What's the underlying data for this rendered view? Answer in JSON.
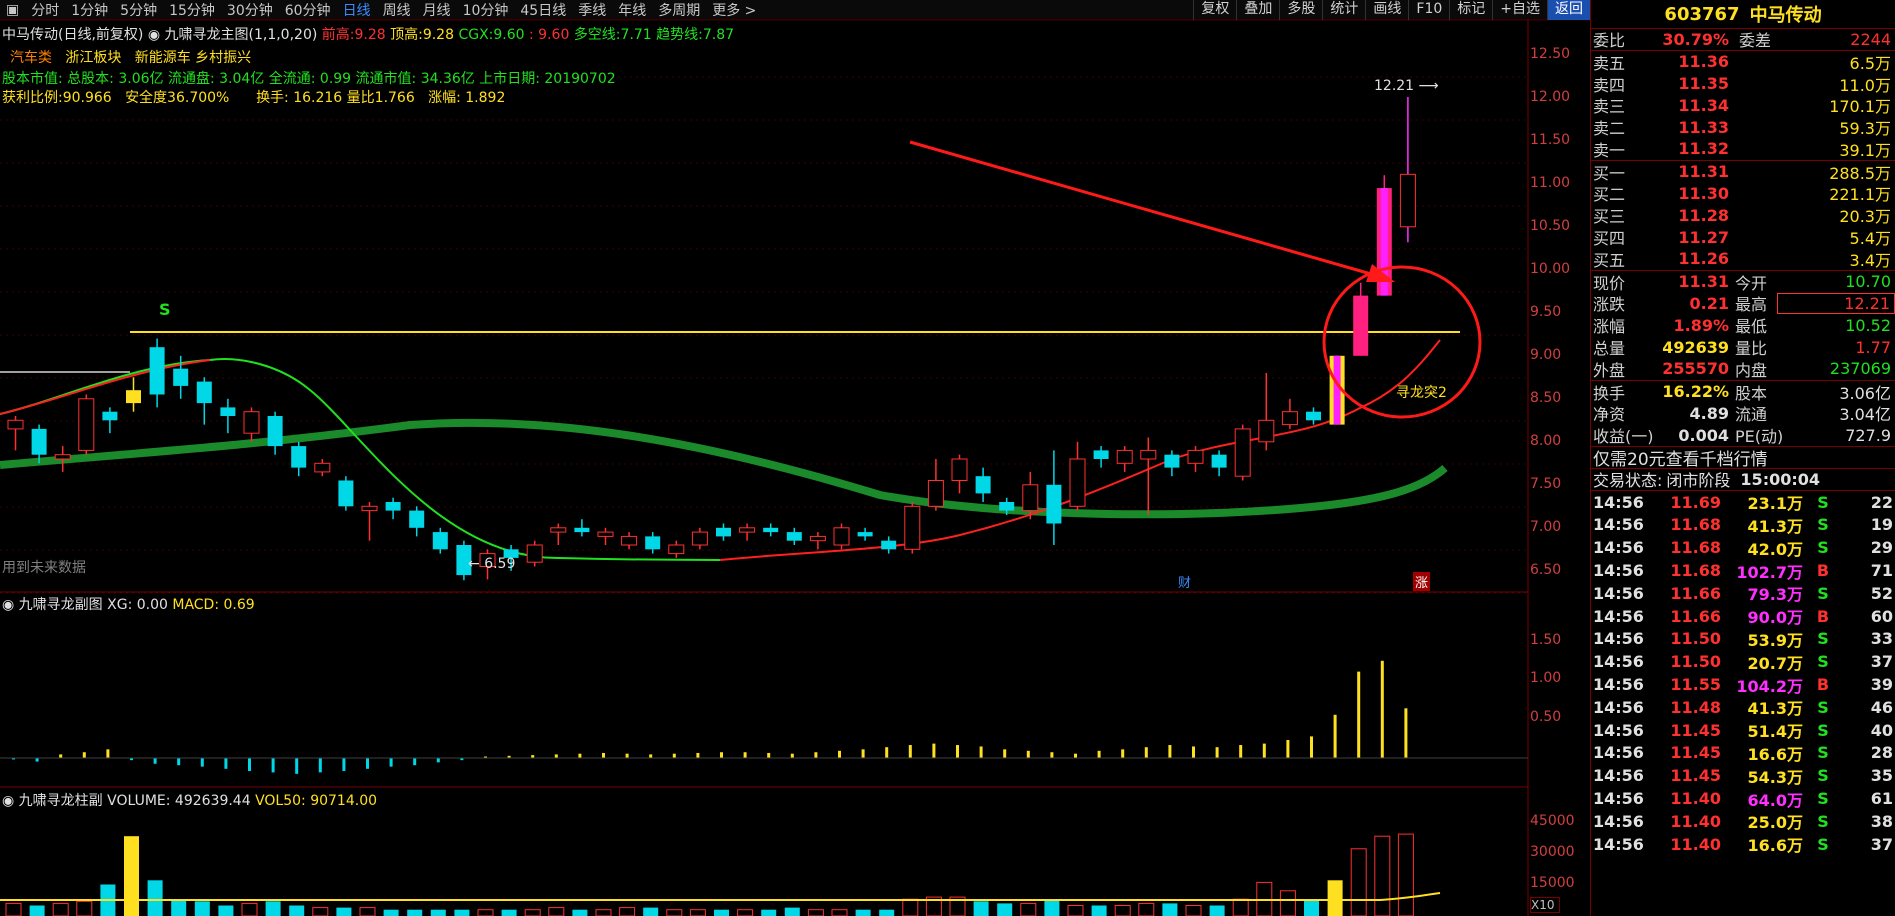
{
  "toolbar": {
    "periods": [
      "分时",
      "1分钟",
      "5分钟",
      "15分钟",
      "30分钟",
      "60分钟",
      "日线",
      "周线",
      "月线",
      "10分钟",
      "45日线",
      "季线",
      "年线",
      "多周期",
      "更多"
    ],
    "active_period": "日线",
    "tools": [
      "复权",
      "叠加",
      "多股",
      "统计",
      "画线",
      "F10",
      "标记",
      "+自选",
      "返回"
    ]
  },
  "main_chart": {
    "title": "中马传动(日线,前复权)",
    "indicator_name": "九啸寻龙主图(1,1,0,20)",
    "qianhigh_label": "前高:",
    "qianhigh": "9.28",
    "dinggao_label": "顶高:",
    "dinggao": "9.28",
    "cgx_label": "CGX:",
    "cgx": "9.60",
    "extra_val": ": 9.60",
    "duokong_label": "多空线:",
    "duokong": "7.71",
    "qushi_label": "趋势线:",
    "qushi": "7.87",
    "sectors": [
      "汽车类",
      "浙江板块",
      "新能源车",
      "乡村振兴"
    ],
    "line3": "股本市值: 总股本: 3.06亿 流通盘: 3.04亿 全流通: 0.99 流通市值: 34.36亿 上市日期: 20190702",
    "line4_a": "获利比例:90.966",
    "line4_b": "安全度36.700%",
    "line4_c": "换手: 16.216 量比1.766",
    "line4_d": "涨幅: 1.892",
    "future_data_note": "用到未来数据",
    "high_label": "12.21",
    "low_label": "6.59",
    "signal_label": "寻龙突2",
    "s_marker": "S",
    "cai_marker": "财",
    "zhang_marker": "涨",
    "y_ticks": [
      "12.50",
      "12.00",
      "11.50",
      "11.00",
      "10.50",
      "10.00",
      "9.50",
      "9.00",
      "8.50",
      "8.00",
      "7.50",
      "7.00",
      "6.50"
    ]
  },
  "sub_chart1": {
    "title": "九啸寻龙副图",
    "xg": "XG: 0.00",
    "macd": "MACD: 0.69",
    "y_ticks": [
      "1.50",
      "1.00",
      "0.50"
    ]
  },
  "sub_chart2": {
    "title": "九啸寻龙柱副",
    "volume": "VOLUME: 492639.44",
    "vol50": "VOL50: 90714.00",
    "y_ticks": [
      "45000",
      "30000",
      "15000"
    ],
    "unit": "X10"
  },
  "quote": {
    "code": "603767",
    "name": "中马传动",
    "weibi_label": "委比",
    "weibi": "30.79%",
    "weicha_label": "委差",
    "weicha": "2244",
    "asks": [
      {
        "label": "卖五",
        "price": "11.36",
        "vol": "6.5万"
      },
      {
        "label": "卖四",
        "price": "11.35",
        "vol": "11.0万"
      },
      {
        "label": "卖三",
        "price": "11.34",
        "vol": "170.1万"
      },
      {
        "label": "卖二",
        "price": "11.33",
        "vol": "59.3万"
      },
      {
        "label": "卖一",
        "price": "11.32",
        "vol": "39.1万"
      }
    ],
    "bids": [
      {
        "label": "买一",
        "price": "11.31",
        "vol": "288.5万"
      },
      {
        "label": "买二",
        "price": "11.30",
        "vol": "221.1万"
      },
      {
        "label": "买三",
        "price": "11.28",
        "vol": "20.3万"
      },
      {
        "label": "买四",
        "price": "11.27",
        "vol": "5.4万"
      },
      {
        "label": "买五",
        "price": "11.26",
        "vol": "3.4万"
      }
    ],
    "stats": [
      {
        "l1": "现价",
        "v1": "11.31",
        "c1": "red",
        "l2": "今开",
        "v2": "10.70",
        "c2": "green"
      },
      {
        "l1": "涨跌",
        "v1": "0.21",
        "c1": "red",
        "l2": "最高",
        "v2": "12.21",
        "c2": "red"
      },
      {
        "l1": "涨幅",
        "v1": "1.89%",
        "c1": "red",
        "l2": "最低",
        "v2": "10.52",
        "c2": "green"
      },
      {
        "l1": "总量",
        "v1": "492639",
        "c1": "yellow",
        "l2": "量比",
        "v2": "1.77",
        "c2": "red"
      },
      {
        "l1": "外盘",
        "v1": "255570",
        "c1": "red",
        "l2": "内盘",
        "v2": "237069",
        "c2": "green"
      }
    ],
    "stats2": [
      {
        "l1": "换手",
        "v1": "16.22%",
        "l2": "股本",
        "v2": "3.06亿"
      },
      {
        "l1": "净资",
        "v1": "4.89",
        "l2": "流通",
        "v2": "3.04亿"
      },
      {
        "l1": "收益(一)",
        "v1": "0.004",
        "l2": "PE(动)",
        "v2": "727.9"
      }
    ],
    "promo": "仅需20元查看千档行情",
    "trade_status_label": "交易状态:",
    "trade_status": "闭市阶段",
    "trade_time": "15:00:04",
    "ticks": [
      {
        "t": "14:56",
        "p": "11.69",
        "v": "23.1万",
        "bs": "S",
        "n": "22",
        "vc": "yellow"
      },
      {
        "t": "14:56",
        "p": "11.68",
        "v": "41.3万",
        "bs": "S",
        "n": "19",
        "vc": "yellow"
      },
      {
        "t": "14:56",
        "p": "11.68",
        "v": "42.0万",
        "bs": "S",
        "n": "29",
        "vc": "yellow"
      },
      {
        "t": "14:56",
        "p": "11.68",
        "v": "102.7万",
        "bs": "B",
        "n": "71",
        "vc": "magenta"
      },
      {
        "t": "14:56",
        "p": "11.66",
        "v": "79.3万",
        "bs": "S",
        "n": "52",
        "vc": "magenta"
      },
      {
        "t": "14:56",
        "p": "11.66",
        "v": "90.0万",
        "bs": "B",
        "n": "60",
        "vc": "magenta"
      },
      {
        "t": "14:56",
        "p": "11.50",
        "v": "53.9万",
        "bs": "S",
        "n": "33",
        "vc": "yellow"
      },
      {
        "t": "14:56",
        "p": "11.50",
        "v": "20.7万",
        "bs": "S",
        "n": "37",
        "vc": "yellow"
      },
      {
        "t": "14:56",
        "p": "11.55",
        "v": "104.2万",
        "bs": "B",
        "n": "39",
        "vc": "magenta"
      },
      {
        "t": "14:56",
        "p": "11.48",
        "v": "41.3万",
        "bs": "S",
        "n": "46",
        "vc": "yellow"
      },
      {
        "t": "14:56",
        "p": "11.45",
        "v": "51.4万",
        "bs": "S",
        "n": "40",
        "vc": "yellow"
      },
      {
        "t": "14:56",
        "p": "11.45",
        "v": "16.6万",
        "bs": "S",
        "n": "28",
        "vc": "yellow"
      },
      {
        "t": "14:56",
        "p": "11.45",
        "v": "54.3万",
        "bs": "S",
        "n": "35",
        "vc": "yellow"
      },
      {
        "t": "14:56",
        "p": "11.40",
        "v": "64.0万",
        "bs": "S",
        "n": "61",
        "vc": "magenta"
      },
      {
        "t": "14:56",
        "p": "11.40",
        "v": "25.0万",
        "bs": "S",
        "n": "38",
        "vc": "yellow"
      },
      {
        "t": "14:56",
        "p": "11.40",
        "v": "16.6万",
        "bs": "S",
        "n": "37",
        "vc": "yellow"
      }
    ]
  },
  "colors": {
    "up": "#ff3030",
    "down": "#00d8e8",
    "yellow": "#ffe020",
    "green_line": "#1a8a2a",
    "red_line": "#ff2020",
    "magenta": "#ff20ff",
    "pink": "#ff2080"
  }
}
